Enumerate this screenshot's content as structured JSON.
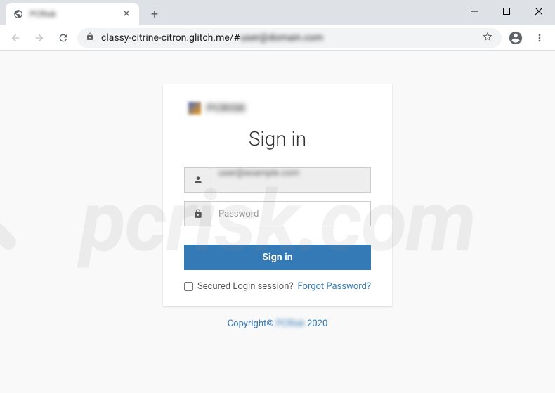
{
  "browser": {
    "tab_title": "PCRisk",
    "url_visible": "classy-citrine-citron.glitch.me/#",
    "url_blurred": "user@domain.com"
  },
  "login": {
    "brand": "PCRISK",
    "title": "Sign in",
    "email_value": "user@example.com",
    "password_placeholder": "Password",
    "button_label": "Sign in",
    "secure_label": "Secured Login session?",
    "forgot_label": "Forgot Password?"
  },
  "footer": {
    "copyright_prefix": "Copyright©",
    "brand_blur": "PCRisk",
    "year": "2020"
  },
  "watermark": {
    "text": "pcrisk.com"
  }
}
